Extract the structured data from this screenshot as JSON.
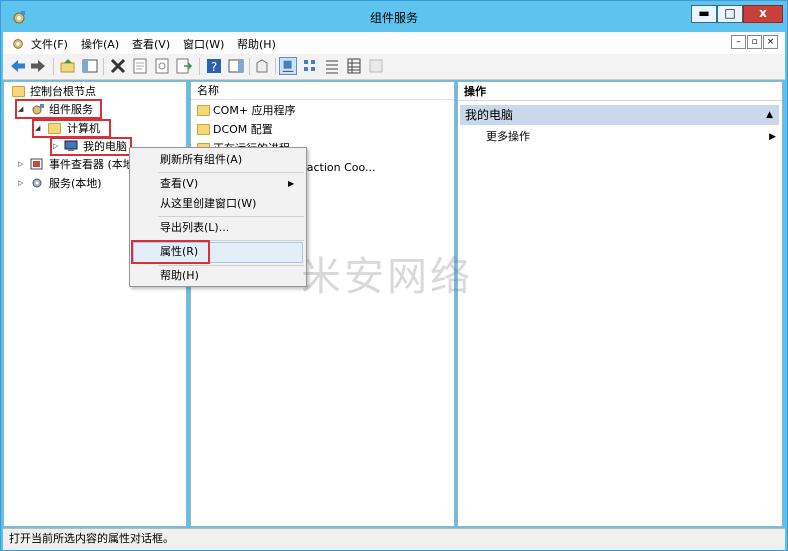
{
  "window": {
    "title": "组件服务",
    "minimize_label": "▬",
    "maximize_label": "□",
    "close_label": "x"
  },
  "menubar": {
    "items": [
      {
        "label": "文件(F)"
      },
      {
        "label": "操作(A)"
      },
      {
        "label": "查看(V)"
      },
      {
        "label": "窗口(W)"
      },
      {
        "label": "帮助(H)"
      }
    ],
    "mdi_min": "–",
    "mdi_restore": "▫",
    "mdi_close": "×"
  },
  "tree": {
    "root": "控制台根节点",
    "component_services": "组件服务",
    "computers": "计算机",
    "my_computer": "我的电脑",
    "event_viewer": "事件查看器 (本地",
    "services": "服务(本地)"
  },
  "list": {
    "column_name": "名称",
    "items": [
      {
        "label": "COM+ 应用程序"
      },
      {
        "label": "DCOM 配置"
      },
      {
        "label": "正在运行的进程"
      },
      {
        "label": "Distributed Transaction Coo..."
      }
    ],
    "partial_item_suffix": "action Coo..."
  },
  "actions": {
    "header": "操作",
    "section": "我的电脑",
    "more": "更多操作"
  },
  "context_menu": {
    "items": [
      {
        "label": "刷新所有组件(A)"
      },
      {
        "label": "查看(V)"
      },
      {
        "label": "从这里创建窗口(W)"
      },
      {
        "label": "导出列表(L)..."
      },
      {
        "label": "属性(R)"
      },
      {
        "label": "帮助(H)"
      }
    ]
  },
  "status": "打开当前所选内容的属性对话框。",
  "watermark": "米安网络",
  "colors": {
    "titlebar": "#5ec4ef",
    "highlight_box": "#d8303a",
    "action_section": "#c9d8ea"
  }
}
